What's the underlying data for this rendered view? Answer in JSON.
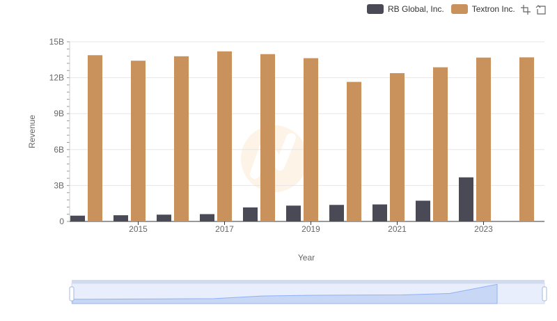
{
  "legend": [
    {
      "name": "RB Global, Inc.",
      "color": "#4a4a56"
    },
    {
      "name": "Textron Inc.",
      "color": "#c9915c"
    }
  ],
  "toolbox": {
    "icons": [
      "zoom-icon",
      "restore-icon"
    ]
  },
  "chart_data": {
    "type": "bar",
    "xlabel": "Year",
    "ylabel": "Revenue",
    "categories": [
      "2014",
      "2015",
      "2016",
      "2017",
      "2018",
      "2019",
      "2020",
      "2021",
      "2022",
      "2023",
      "2024"
    ],
    "x_tick_labels": [
      "2015",
      "2017",
      "2019",
      "2021",
      "2023"
    ],
    "y_ticks": [
      0,
      3000000000,
      6000000000,
      9000000000,
      12000000000,
      15000000000
    ],
    "y_tick_labels": [
      "0",
      "3B",
      "6B",
      "9B",
      "12B",
      "15B"
    ],
    "ylim": [
      0,
      15000000000
    ],
    "grid": true,
    "legend_position": "top-right",
    "series": [
      {
        "name": "RB Global, Inc.",
        "color": "#4a4a56",
        "values": [
          481000000,
          516000000,
          566000000,
          610000000,
          1170000000,
          1320000000,
          1380000000,
          1420000000,
          1730000000,
          3680000000,
          null
        ]
      },
      {
        "name": "Textron Inc.",
        "color": "#c9915c",
        "values": [
          13880000000,
          13420000000,
          13790000000,
          14200000000,
          13970000000,
          13630000000,
          11650000000,
          12380000000,
          12870000000,
          13680000000,
          13700000000
        ]
      }
    ]
  }
}
